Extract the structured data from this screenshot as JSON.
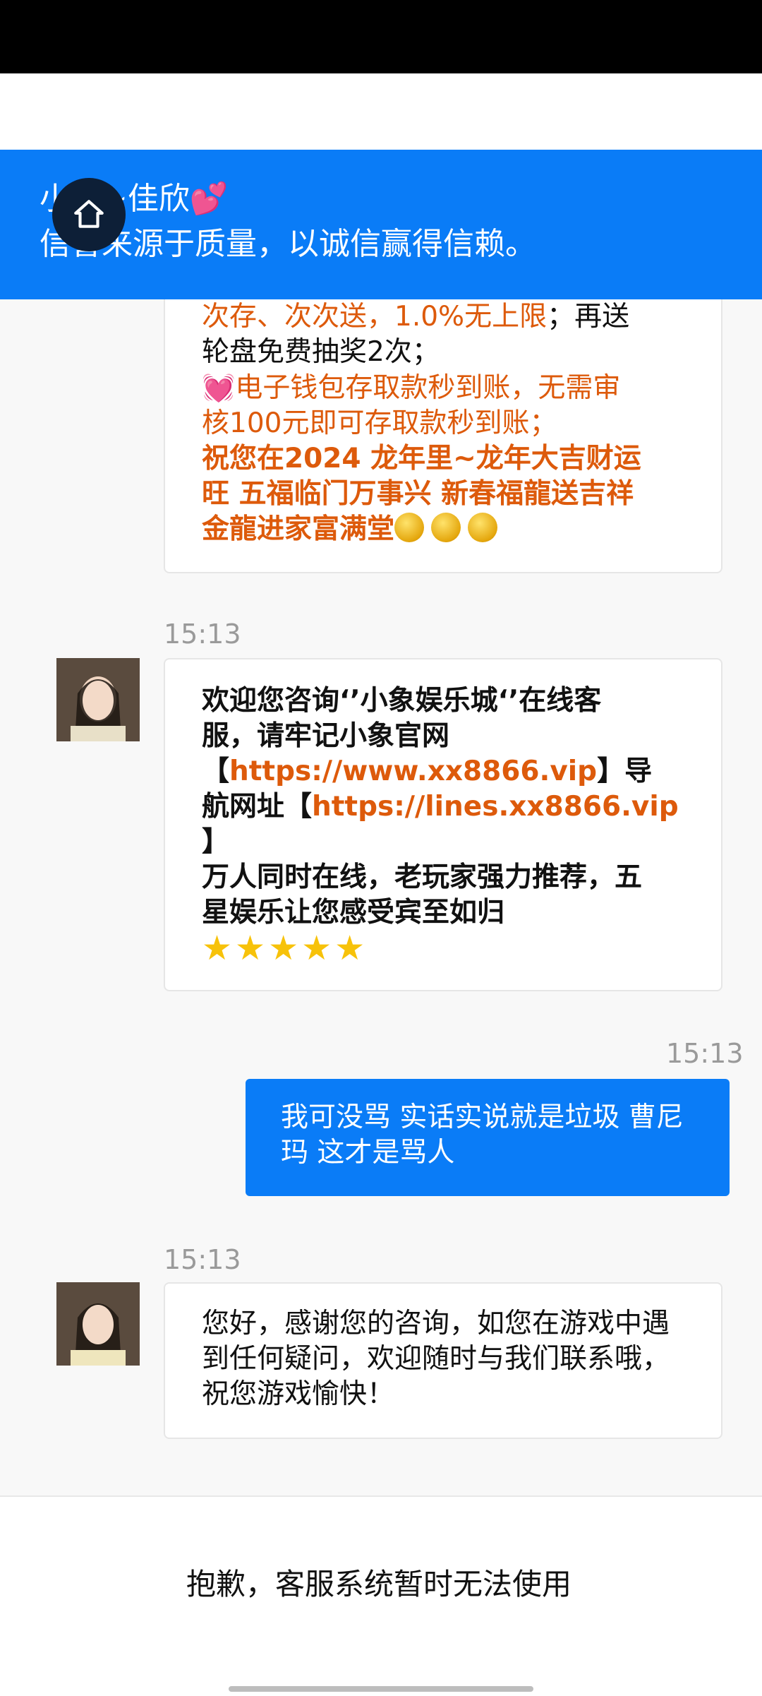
{
  "header": {
    "title": "小象~佳欣💕",
    "subtitle": "信誉来源于质量，以诚信赢得信赖。"
  },
  "messages": [
    {
      "partial_lines": {
        "l1_orange": "次存、次次送，1.0%无上限",
        "l1_tail": "；再送",
        "l2": "轮盘免费抽奖2次；",
        "l3_icon": "💓",
        "l3_orange": "电子钱包存取款秒到账，无需审",
        "l4_orange": "核100元即可存取款秒到账；",
        "l5_bold": "祝您在2024 龙年里~龙年大吉财运",
        "l6_bold": "旺 五福临门万事兴 新春福龍送吉祥",
        "l7_bold": "金龍进家富满堂"
      }
    },
    {
      "time": "15:13",
      "l1": "欢迎您咨询‘’小象娱乐城‘’在线客",
      "l2": "服，请牢记小象官网",
      "l3_open": "【",
      "l3_link": "https://www.xx8866.vip",
      "l3_close": "】导",
      "l4_pre": "航网址【",
      "l4_link": "https://lines.xx8866.vip",
      "l5": "】",
      "l6": "万人同时在线，老玩家强力推荐，五",
      "l7": "星娱乐让您感受宾至如归",
      "stars": "★★★★★"
    },
    {
      "time": "15:13",
      "text": "我可没骂 实话实说就是垃圾 曹尼玛 这才是骂人"
    },
    {
      "time": "15:13",
      "text": "您好，感谢您的咨询，如您在游戏中遇到任何疑问，欢迎随时与我们联系哦，祝您游戏愉快！"
    }
  ],
  "bottom": {
    "notice": "抱歉，客服系统暂时无法使用"
  },
  "colors": {
    "accent": "#0a7cf7",
    "highlight": "#dd5a0b"
  }
}
